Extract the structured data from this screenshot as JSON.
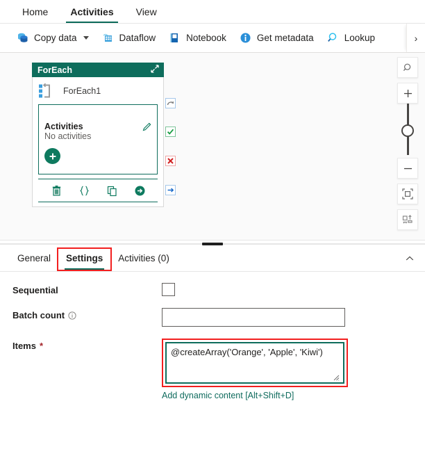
{
  "ribbon": {
    "tabs": [
      {
        "label": "Home",
        "active": false
      },
      {
        "label": "Activities",
        "active": true
      },
      {
        "label": "View",
        "active": false
      }
    ]
  },
  "commandbar": {
    "items": [
      {
        "label": "Copy data",
        "icon": "database-icon",
        "has_caret": true
      },
      {
        "label": "Dataflow",
        "icon": "dataflow-icon",
        "has_caret": false
      },
      {
        "label": "Notebook",
        "icon": "notebook-icon",
        "has_caret": false
      },
      {
        "label": "Get metadata",
        "icon": "info-circle-icon",
        "has_caret": false
      },
      {
        "label": "Lookup",
        "icon": "magnifier-icon",
        "has_caret": false
      }
    ],
    "overflow_label": "›"
  },
  "canvas": {
    "node": {
      "header_title": "ForEach",
      "collapse_icon": "expand-collapse-arrows-icon",
      "activity_name": "ForEach1",
      "inner_title": "Activities",
      "inner_subtitle": "No activities",
      "edit_icon": "pencil-icon",
      "add_icon": "plus-icon",
      "actions": [
        {
          "name": "delete-activity-button",
          "icon": "trash-icon"
        },
        {
          "name": "code-view-button",
          "icon": "curly-braces-icon"
        },
        {
          "name": "clone-activity-button",
          "icon": "copy-icon"
        },
        {
          "name": "run-activity-button",
          "icon": "arrow-circle-right-icon"
        }
      ],
      "badges": [
        {
          "name": "on-skip-connector",
          "icon": "skip-arrow-icon"
        },
        {
          "name": "on-success-connector",
          "icon": "check-icon"
        },
        {
          "name": "on-failure-connector",
          "icon": "x-icon"
        },
        {
          "name": "on-completion-connector",
          "icon": "arrow-right-icon"
        }
      ]
    },
    "controls": [
      {
        "name": "zoom-search-button",
        "icon": "magnifier-icon"
      },
      {
        "name": "zoom-in-button",
        "icon": "plus-icon"
      },
      {
        "name": "zoom-out-button",
        "icon": "minus-icon"
      },
      {
        "name": "fit-to-screen-button",
        "icon": "fit-screen-icon"
      },
      {
        "name": "auto-align-button",
        "icon": "auto-align-icon"
      }
    ]
  },
  "properties": {
    "tabs": [
      {
        "label": "General",
        "active": false,
        "highlight": false
      },
      {
        "label": "Settings",
        "active": true,
        "highlight": true
      },
      {
        "label": "Activities (0)",
        "active": false,
        "highlight": false
      }
    ],
    "collapse_icon": "chevron-up-icon",
    "fields": {
      "sequential": {
        "label": "Sequential",
        "checked": false
      },
      "batch_count": {
        "label": "Batch count",
        "value": "",
        "placeholder": "",
        "info_icon": "info-icon"
      },
      "items": {
        "label": "Items",
        "required_marker": "*",
        "value": "@createArray('Orange', 'Apple', 'Kiwi')",
        "placeholder": "",
        "dynamic_content_link": "Add dynamic content [Alt+Shift+D]"
      }
    }
  },
  "colors": {
    "accent_green": "#0e6d5c",
    "highlight_red": "#f21f1f",
    "link_green": "#0f6b5d",
    "blue_icon": "#2e8fd6"
  }
}
